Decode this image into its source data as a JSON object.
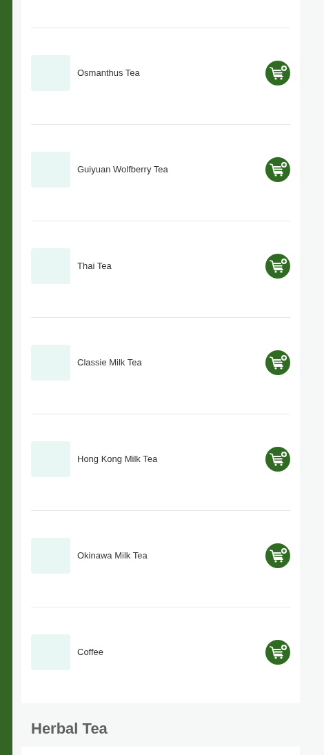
{
  "sections": [
    {
      "items": [
        {
          "name": "Osmanthus Tea"
        },
        {
          "name": "Guiyuan Wolfberry Tea"
        },
        {
          "name": "Thai Tea"
        },
        {
          "name": "Classie Milk Tea"
        },
        {
          "name": "Hong Kong Milk Tea"
        },
        {
          "name": "Okinawa Milk Tea"
        },
        {
          "name": "Coffee"
        }
      ]
    },
    {
      "title": "Herbal Tea"
    }
  ]
}
